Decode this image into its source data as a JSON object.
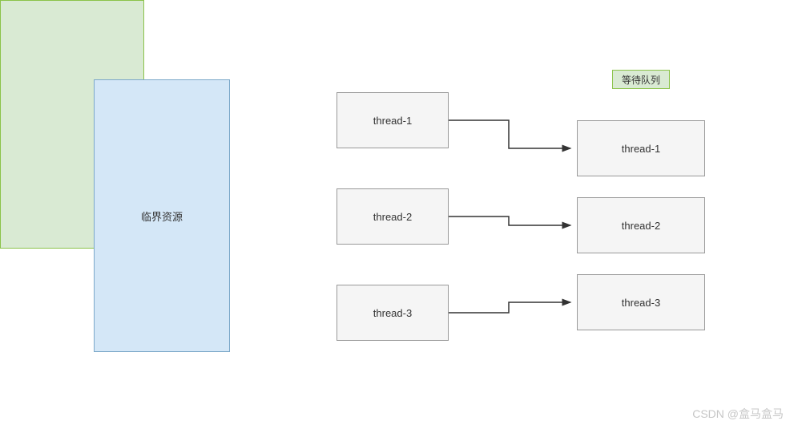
{
  "critical_resource_label": "临界资源",
  "threads": {
    "t1": "thread-1",
    "t2": "thread-2",
    "t3": "thread-3"
  },
  "queue": {
    "label": "等待队列",
    "items": {
      "q1": "thread-1",
      "q2": "thread-2",
      "q3": "thread-3"
    }
  },
  "watermark": "CSDN @盒马盒马"
}
